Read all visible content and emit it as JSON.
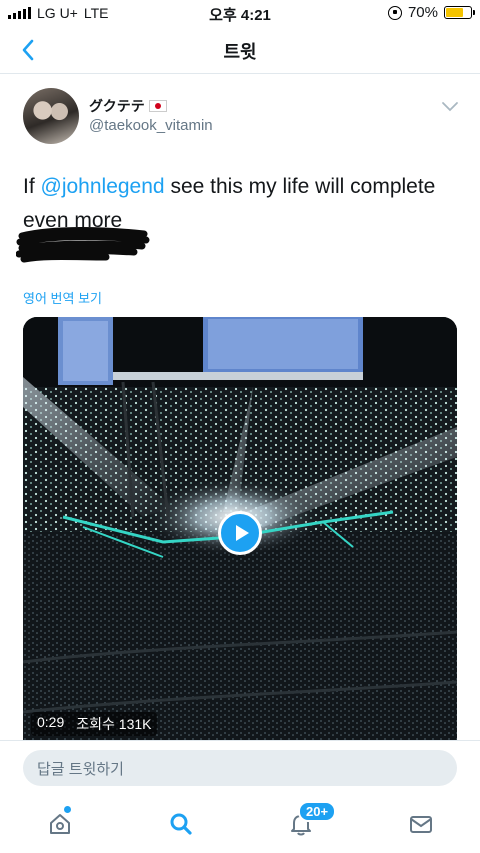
{
  "status_bar": {
    "carrier": "LG U+",
    "network": "LTE",
    "time": "오후 4:21",
    "battery": "70%",
    "battery_level": 0.7,
    "battery_color": "#f5c400"
  },
  "nav": {
    "title": "트윗",
    "back_icon": "chevron-left-icon"
  },
  "tweet": {
    "display_name": "グクテテ",
    "flag": "🇯🇵",
    "handle": "@taekook_vitamin",
    "text_prefix": "If ",
    "mention": "@johnlegend",
    "text_suffix": " see this my life will complete even more",
    "translate_label": "영어 번역 보기"
  },
  "video": {
    "duration": "0:29",
    "views": "조회수 131K"
  },
  "reply": {
    "placeholder": "답글 트윗하기"
  },
  "tab_bar": {
    "items": [
      {
        "name": "home",
        "icon": "home-icon"
      },
      {
        "name": "search",
        "icon": "search-icon"
      },
      {
        "name": "notifications",
        "icon": "bell-icon"
      },
      {
        "name": "messages",
        "icon": "mail-icon"
      }
    ],
    "notification_badge": "20+"
  },
  "colors": {
    "accent": "#1da1f2",
    "text": "#14171a",
    "muted": "#657786"
  }
}
